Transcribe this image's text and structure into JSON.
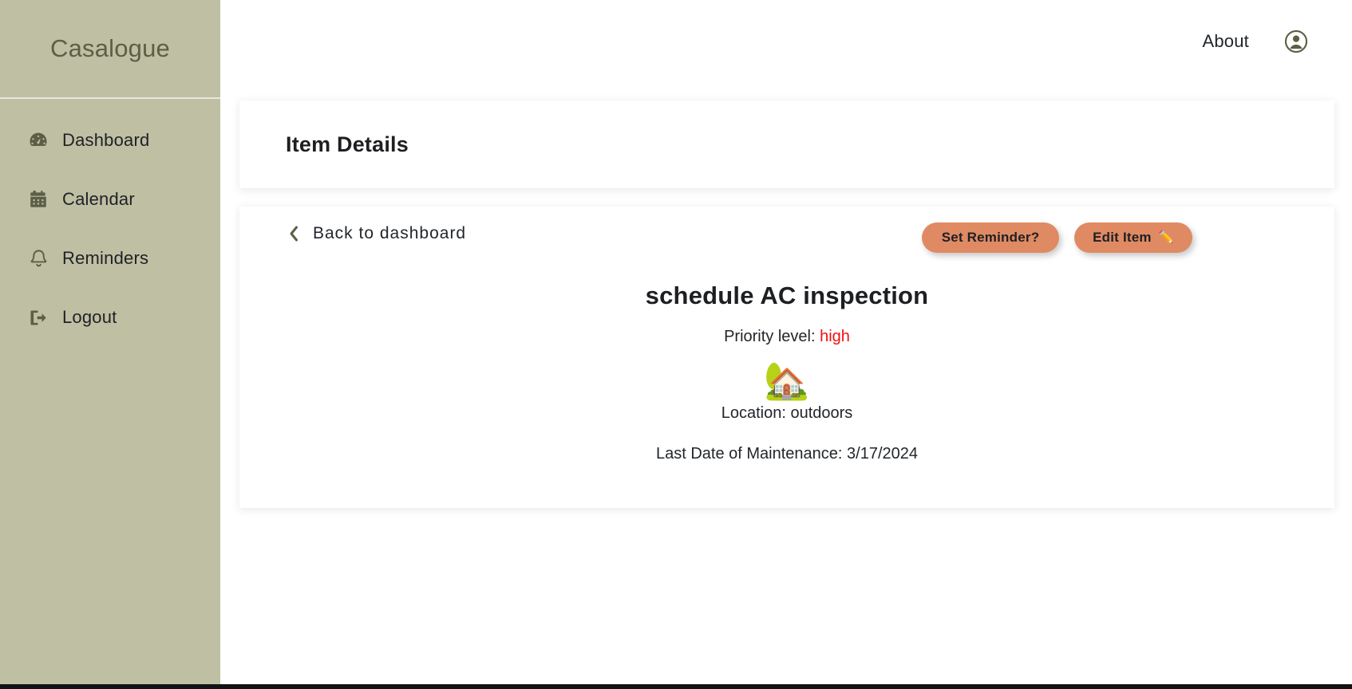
{
  "sidebar": {
    "brand": "Casalogue",
    "items": [
      {
        "label": "Dashboard",
        "icon": "gauge-icon"
      },
      {
        "label": "Calendar",
        "icon": "calendar-icon"
      },
      {
        "label": "Reminders",
        "icon": "bell-icon"
      },
      {
        "label": "Logout",
        "icon": "logout-icon"
      }
    ],
    "background_color": "#bfbfa4",
    "brand_color": "#5c5f45"
  },
  "topbar": {
    "about_label": "About",
    "account_icon": "user-circle-icon"
  },
  "header_card": {
    "title": "Item Details"
  },
  "detail_card": {
    "back_label": "Back to dashboard",
    "back_icon": "chevron-left-icon",
    "set_reminder_label": "Set Reminder?",
    "edit_item_label": "Edit Item",
    "edit_item_icon": "pencil-icon",
    "edit_item_emoji": "✏️",
    "button_color": "#e08a63",
    "item_title": "schedule AC inspection",
    "priority_label": "Priority level:",
    "priority_value": "high",
    "priority_color": "#f40f0f",
    "location_emoji": "🏡",
    "location_text": "Location: outdoors",
    "maintenance_text": "Last Date of Maintenance: 3/17/2024"
  }
}
